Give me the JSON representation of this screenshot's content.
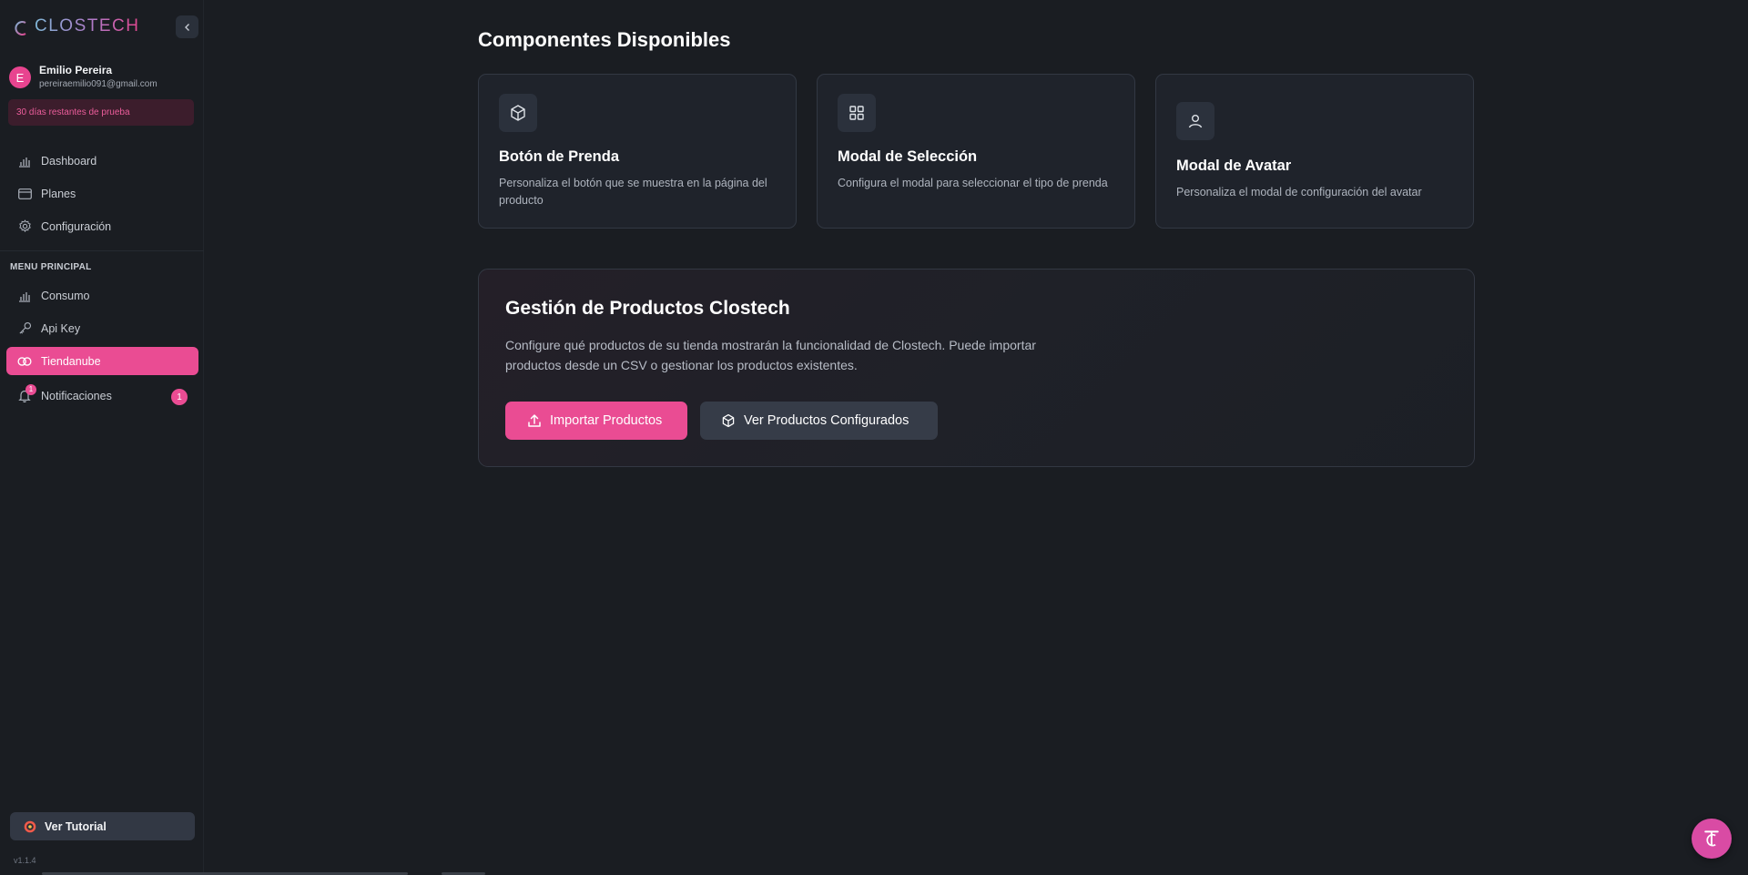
{
  "app": {
    "brand": "CLOSTECH"
  },
  "user": {
    "initial": "E",
    "name": "Emilio Pereira",
    "email": "pereiraemilio091@gmail.com"
  },
  "trial": {
    "text": "30 días restantes de prueba"
  },
  "nav_top": [
    {
      "label": "Dashboard",
      "icon": "bar-chart-icon"
    },
    {
      "label": "Planes",
      "icon": "credit-card-icon"
    },
    {
      "label": "Configuración",
      "icon": "gear-icon"
    }
  ],
  "section_label": "MENU PRINCIPAL",
  "nav_main": [
    {
      "label": "Consumo",
      "icon": "bar-chart-icon"
    },
    {
      "label": "Api Key",
      "icon": "key-icon"
    },
    {
      "label": "Tiendanube",
      "icon": "cloud-icon",
      "active": true
    },
    {
      "label": "Notificaciones",
      "icon": "bell-icon",
      "badge": "1",
      "dot": "1"
    }
  ],
  "tutorial": {
    "label": "Ver Tutorial"
  },
  "version": "v1.1.4",
  "main": {
    "title": "Componentes Disponibles",
    "cards": [
      {
        "title": "Botón de Prenda",
        "desc": "Personaliza el botón que se muestra en la página del producto",
        "icon": "box-icon"
      },
      {
        "title": "Modal de Selección",
        "desc": "Configura el modal para seleccionar el tipo de prenda",
        "icon": "grid-icon"
      },
      {
        "title": "Modal de Avatar",
        "desc": "Personaliza el modal de configuración del avatar",
        "icon": "user-icon"
      }
    ],
    "panel": {
      "title": "Gestión de Productos Clostech",
      "desc": "Configure qué productos de su tienda mostrarán la funcionalidad de Clostech. Puede importar productos desde un CSV o gestionar los productos existentes.",
      "primary_button": "Importar Productos",
      "secondary_button": "Ver Productos Configurados"
    }
  },
  "colors": {
    "accent": "#ea4c93",
    "background": "#1a1d22",
    "card": "#1f232b"
  }
}
